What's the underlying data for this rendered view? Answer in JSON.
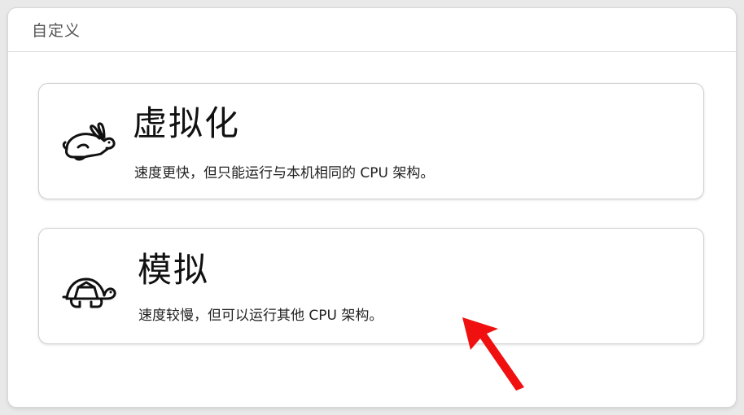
{
  "header": {
    "title": "自定义"
  },
  "options": [
    {
      "title": "虚拟化",
      "description": "速度更快，但只能运行与本机相同的 CPU 架构。",
      "icon": "rabbit-icon"
    },
    {
      "title": "模拟",
      "description": "速度较慢，但可以运行其他 CPU 架构。",
      "icon": "turtle-icon"
    }
  ],
  "annotation": {
    "arrow_color": "#f01010"
  }
}
